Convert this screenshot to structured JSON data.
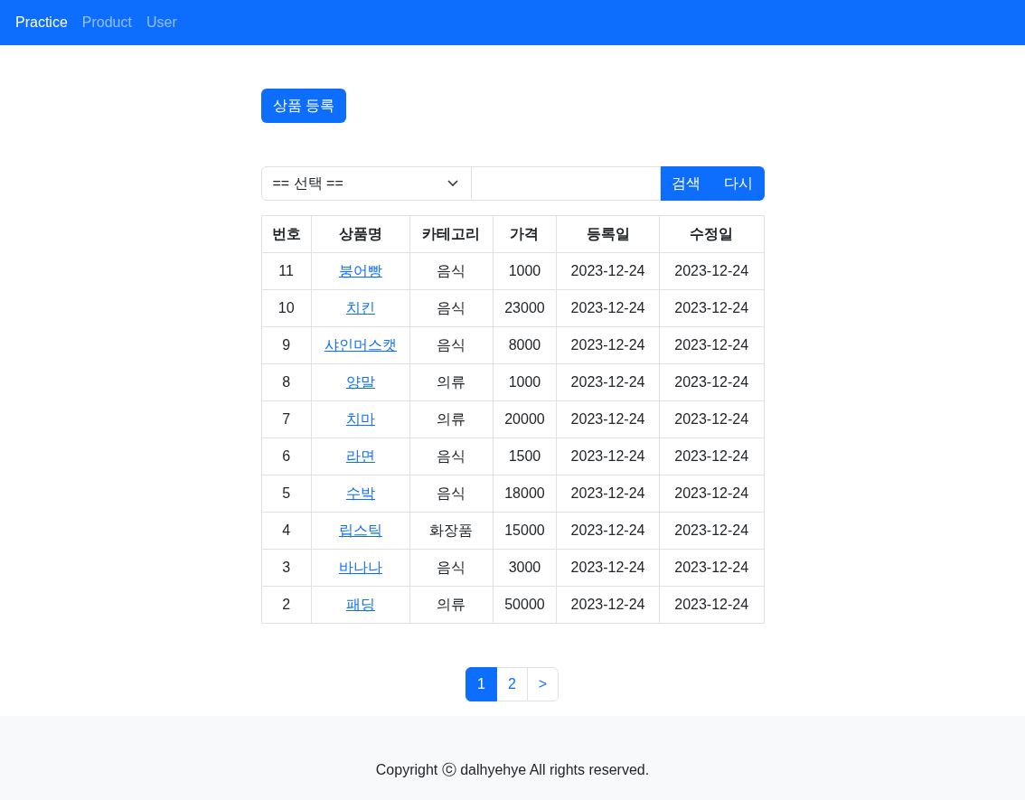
{
  "navbar": {
    "brand": "Practice",
    "links": [
      "Product",
      "User"
    ]
  },
  "register_button": "상품 등록",
  "search": {
    "select": "== 선택 ==",
    "buttons": [
      "검색",
      "다시"
    ]
  },
  "table": {
    "columns": [
      "번호",
      "상품명",
      "카테고리",
      "가격",
      "등록일",
      "수정일"
    ],
    "rows": [
      [
        "11",
        "붕어빵",
        "음식",
        "1000",
        "2023-12-24",
        "2023-12-24"
      ],
      [
        "10",
        "치킨",
        "음식",
        "23000",
        "2023-12-24",
        "2023-12-24"
      ],
      [
        "9",
        "샤인머스캣",
        "음식",
        "8000",
        "2023-12-24",
        "2023-12-24"
      ],
      [
        "8",
        "양말",
        "의류",
        "1000",
        "2023-12-24",
        "2023-12-24"
      ],
      [
        "7",
        "치마",
        "의류",
        "20000",
        "2023-12-24",
        "2023-12-24"
      ],
      [
        "6",
        "라면",
        "음식",
        "1500",
        "2023-12-24",
        "2023-12-24"
      ],
      [
        "5",
        "수박",
        "음식",
        "18000",
        "2023-12-24",
        "2023-12-24"
      ],
      [
        "4",
        "립스틱",
        "화장품",
        "15000",
        "2023-12-24",
        "2023-12-24"
      ],
      [
        "3",
        "바나나",
        "음식",
        "3000",
        "2023-12-24",
        "2023-12-24"
      ],
      [
        "2",
        "패딩",
        "의류",
        "50000",
        "2023-12-24",
        "2023-12-24"
      ]
    ]
  },
  "pagination": [
    {
      "label": "1",
      "selected": true
    },
    {
      "label": "2",
      "selected": false
    },
    {
      "label": ">",
      "selected": false
    }
  ],
  "footer": "Copyright ⓒ dalhyehye All rights reserved."
}
